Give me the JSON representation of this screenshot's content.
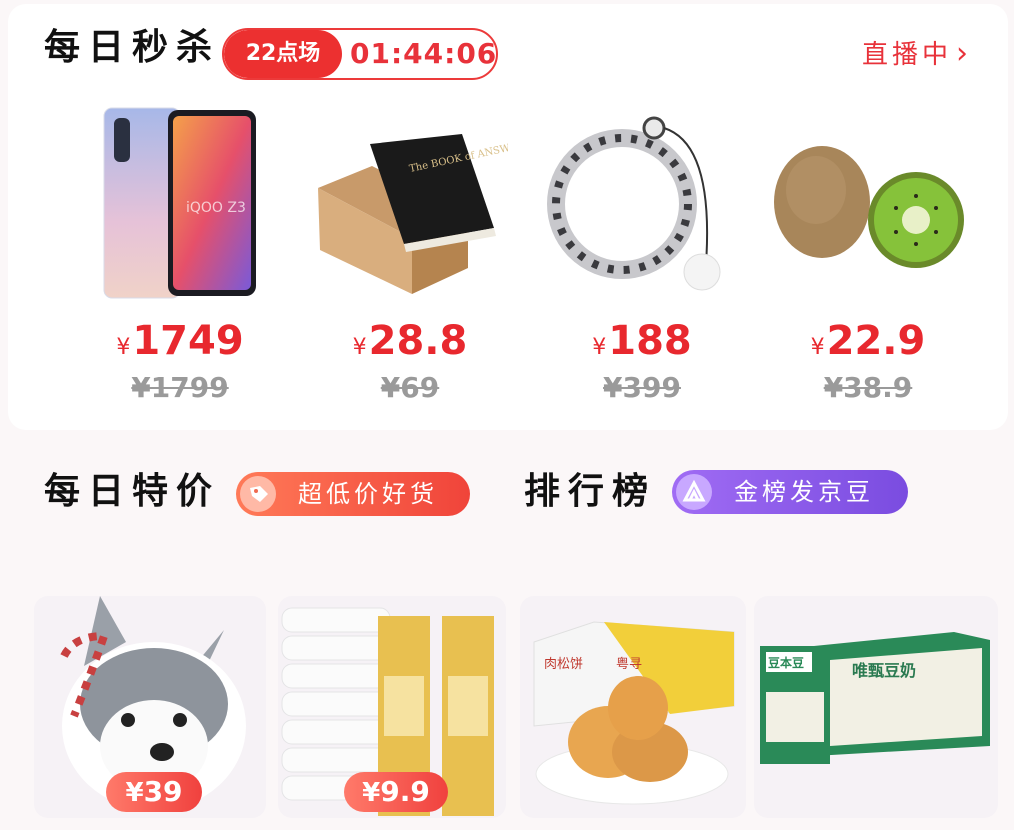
{
  "flash_sale": {
    "title": "每日秒杀",
    "session_label": "22点场",
    "countdown": "01:44:06",
    "live_label": "直播中",
    "chevron": "›",
    "products": [
      {
        "name": "phone",
        "price": "1749",
        "original_price": "¥1799"
      },
      {
        "name": "book",
        "price": "28.8",
        "original_price": "¥69"
      },
      {
        "name": "hula-hoop",
        "price": "188",
        "original_price": "¥399"
      },
      {
        "name": "kiwi",
        "price": "22.9",
        "original_price": "¥38.9"
      }
    ],
    "currency": "¥"
  },
  "daily_deals": {
    "title": "每日特价",
    "tag": "超低价好货"
  },
  "ranking": {
    "title": "排行榜",
    "tag": "金榜发京豆"
  },
  "tiles": [
    {
      "name": "husky-plush",
      "price": "39"
    },
    {
      "name": "tissue-paper",
      "price": "9.9"
    },
    {
      "name": "pork-floss-cake",
      "price": ""
    },
    {
      "name": "soy-milk",
      "price": ""
    }
  ],
  "product_labels": {
    "phone_brand": "iQOO Z3",
    "book_title": "The BOOK of ANSWERS",
    "cake_box_brand": "肉松饼",
    "cake_box_brand2": "粤寻",
    "soy_brand": "豆本豆",
    "soy_name": "唯甄豆奶"
  },
  "colors": {
    "accent_red": "#e8323a",
    "session_red": "#ec3030",
    "orange_pill": "#f05a3c",
    "purple_pill": "#8a55e8"
  }
}
